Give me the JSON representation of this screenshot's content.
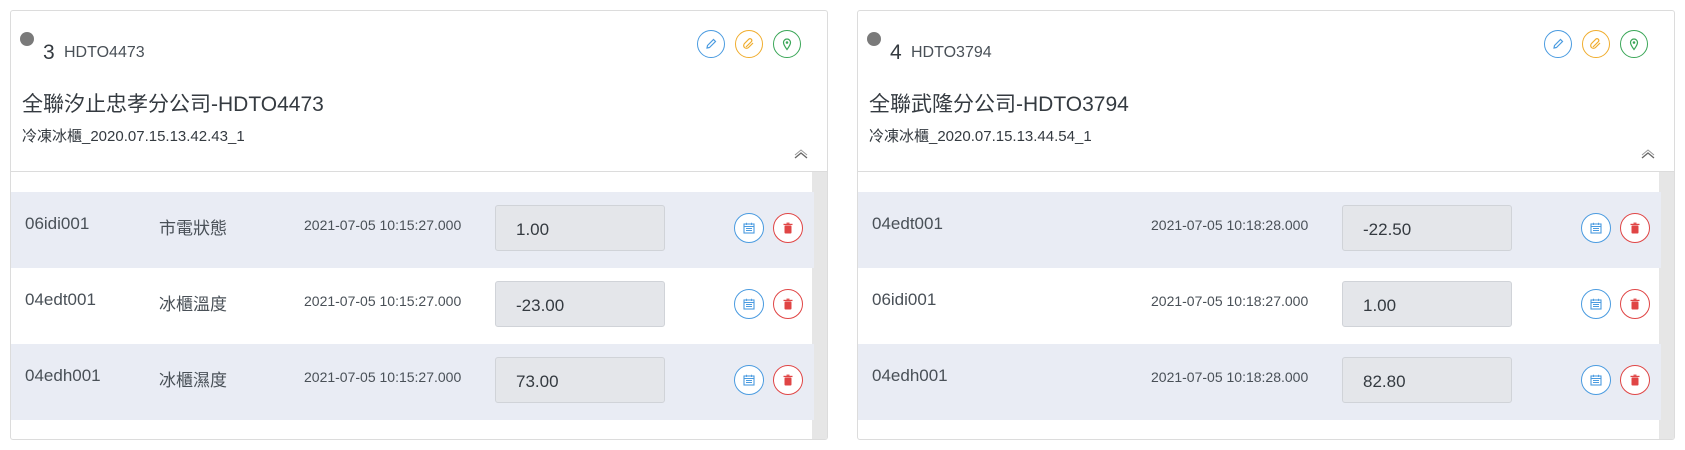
{
  "cards": [
    {
      "number": "3",
      "device_code": "HDTO4473",
      "store_name": "全聯汐止忠孝分公司-HDTO4473",
      "sub_name": "冷凍冰櫃_2020.07.15.13.42.43_1",
      "rows": [
        {
          "code": "06idi001",
          "label": "市電狀態",
          "time": "2021-07-05 10:15:27.000",
          "value": "1.00"
        },
        {
          "code": "04edt001",
          "label": "冰櫃溫度",
          "time": "2021-07-05 10:15:27.000",
          "value": "-23.00"
        },
        {
          "code": "04edh001",
          "label": "冰櫃濕度",
          "time": "2021-07-05 10:15:27.000",
          "value": "73.00"
        }
      ]
    },
    {
      "number": "4",
      "device_code": "HDTO3794",
      "store_name": "全聯武隆分公司-HDTO3794",
      "sub_name": "冷凍冰櫃_2020.07.15.13.44.54_1",
      "rows": [
        {
          "code": "04edt001",
          "label": "",
          "time": "2021-07-05 10:18:28.000",
          "value": "-22.50"
        },
        {
          "code": "06idi001",
          "label": "",
          "time": "2021-07-05 10:18:27.000",
          "value": "1.00"
        },
        {
          "code": "04edh001",
          "label": "",
          "time": "2021-07-05 10:18:28.000",
          "value": "82.80"
        }
      ]
    }
  ],
  "colors": {
    "status_dot": "#7a7a7a",
    "edit_blue": "#4a9be0",
    "tag_orange": "#f0ad2e",
    "location_green": "#3aa657",
    "delete_red": "#e04545",
    "row_alt_bg": "#e9ecf4"
  },
  "icons": {
    "header_buttons": [
      "pencil-icon",
      "tag-icon",
      "map-pin-icon"
    ],
    "row_buttons": [
      "calendar-icon",
      "trash-icon"
    ],
    "collapse": "chevron-up-icon"
  }
}
